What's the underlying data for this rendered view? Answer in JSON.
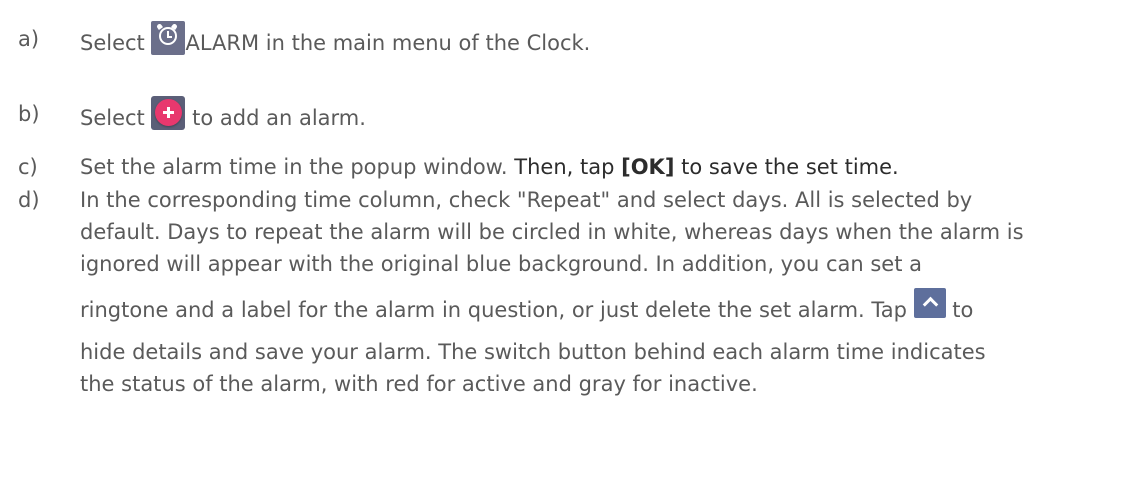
{
  "steps": [
    {
      "marker": "a)",
      "before": "Select ",
      "icon": "alarm-clock-icon",
      "after": "ALARM in the main menu of the Clock."
    },
    {
      "marker": "b)",
      "before": "Select ",
      "icon": "add-alarm-icon",
      "after": " to add an alarm."
    },
    {
      "marker": "c)",
      "part1": "Set the alarm time in the popup window. ",
      "part2": "Then, tap ",
      "bold": "[OK]",
      "part3": " to save the set time."
    },
    {
      "marker": "d)",
      "lines": [
        "In the corresponding time column, check \"Repeat\" and select days. All is selected by",
        "default. Days to repeat the alarm will be circled in white, whereas days when the alarm is",
        "ignored will appear with the original blue background. In addition, you can set a"
      ],
      "line4_before": "ringtone and a label for the alarm in question, or just delete the set alarm. Tap ",
      "line4_icon": "collapse-chevron-icon",
      "line4_after": " to",
      "lines_after": [
        "hide details and save your alarm. The switch button behind each alarm time indicates",
        "the status of the alarm, with red for active and gray for inactive."
      ]
    }
  ],
  "colors": {
    "text": "#5a5a5a",
    "text_dark": "#2c2c2c",
    "alarm_icon_bg": "#6b6f8a",
    "add_icon_pink": "#e8386e",
    "collapse_icon_bg": "#5e6f9c"
  }
}
